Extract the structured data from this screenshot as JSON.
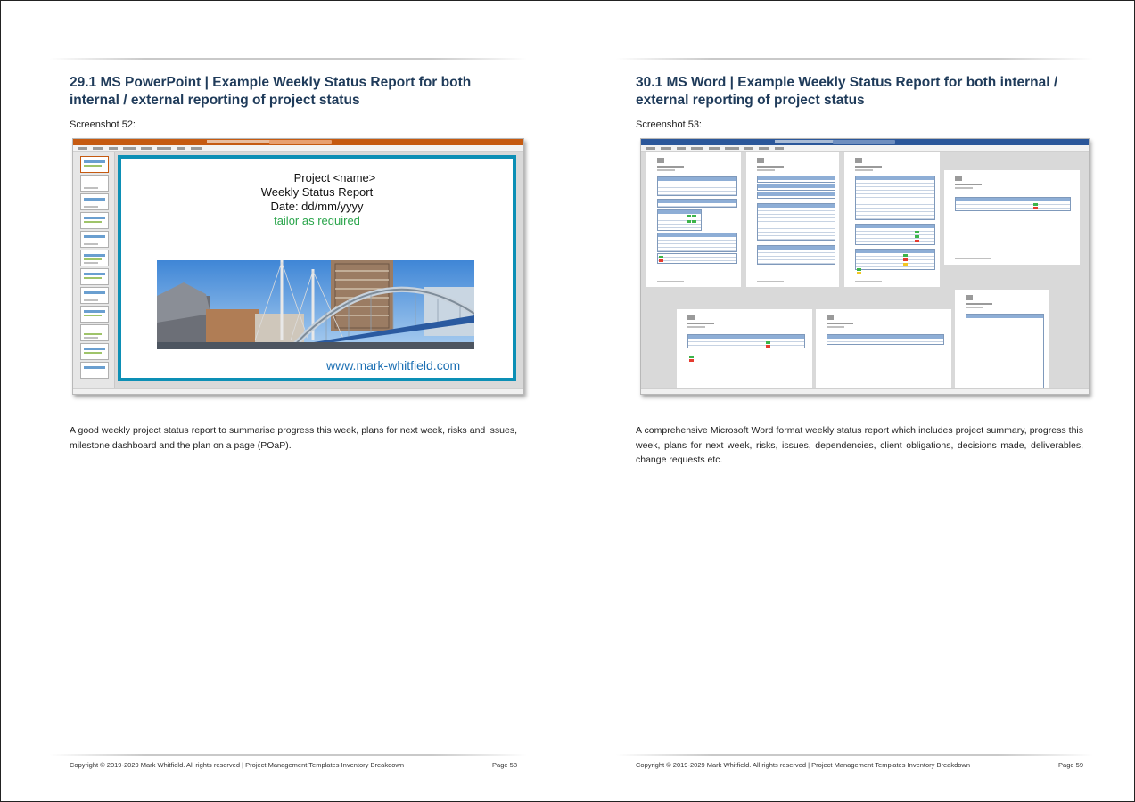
{
  "left_page": {
    "heading": "29.1  MS PowerPoint | Example Weekly Status Report for both internal / external reporting of project status",
    "caption": "Screenshot 52:",
    "slide": {
      "line1": "Project <name>",
      "line2": "Weekly Status Report",
      "line3": "Date: dd/mm/yyyy",
      "line4": "tailor as required",
      "url": "www.mark-whitfield.com"
    },
    "description": "A good weekly project status report to summarise progress this week, plans for next week, risks and issues, milestone dashboard and the plan on a page (POaP).",
    "footer_text": "Copyright © 2019-2029 Mark Whitfield. All rights reserved | Project Management Templates Inventory Breakdown",
    "page_number": "Page 58"
  },
  "right_page": {
    "heading": "30.1  MS Word | Example Weekly Status Report for both internal / external reporting of project status",
    "caption": "Screenshot 53:",
    "description": "A comprehensive Microsoft Word format weekly status report which includes project summary, progress this week, plans for next week, risks, issues, dependencies, client obligations, decisions made, deliverables, change requests etc.",
    "footer_text": "Copyright © 2019-2029 Mark Whitfield. All rights reserved | Project Management Templates Inventory Breakdown",
    "page_number": "Page 59"
  },
  "colors": {
    "heading": "#1f3b5a",
    "powerpoint_titlebar": "#c55a11",
    "word_titlebar": "#2b579a",
    "slide_border": "#0c8fb5",
    "tailor_text": "#2aa54b",
    "url_text": "#1b6fb3"
  }
}
